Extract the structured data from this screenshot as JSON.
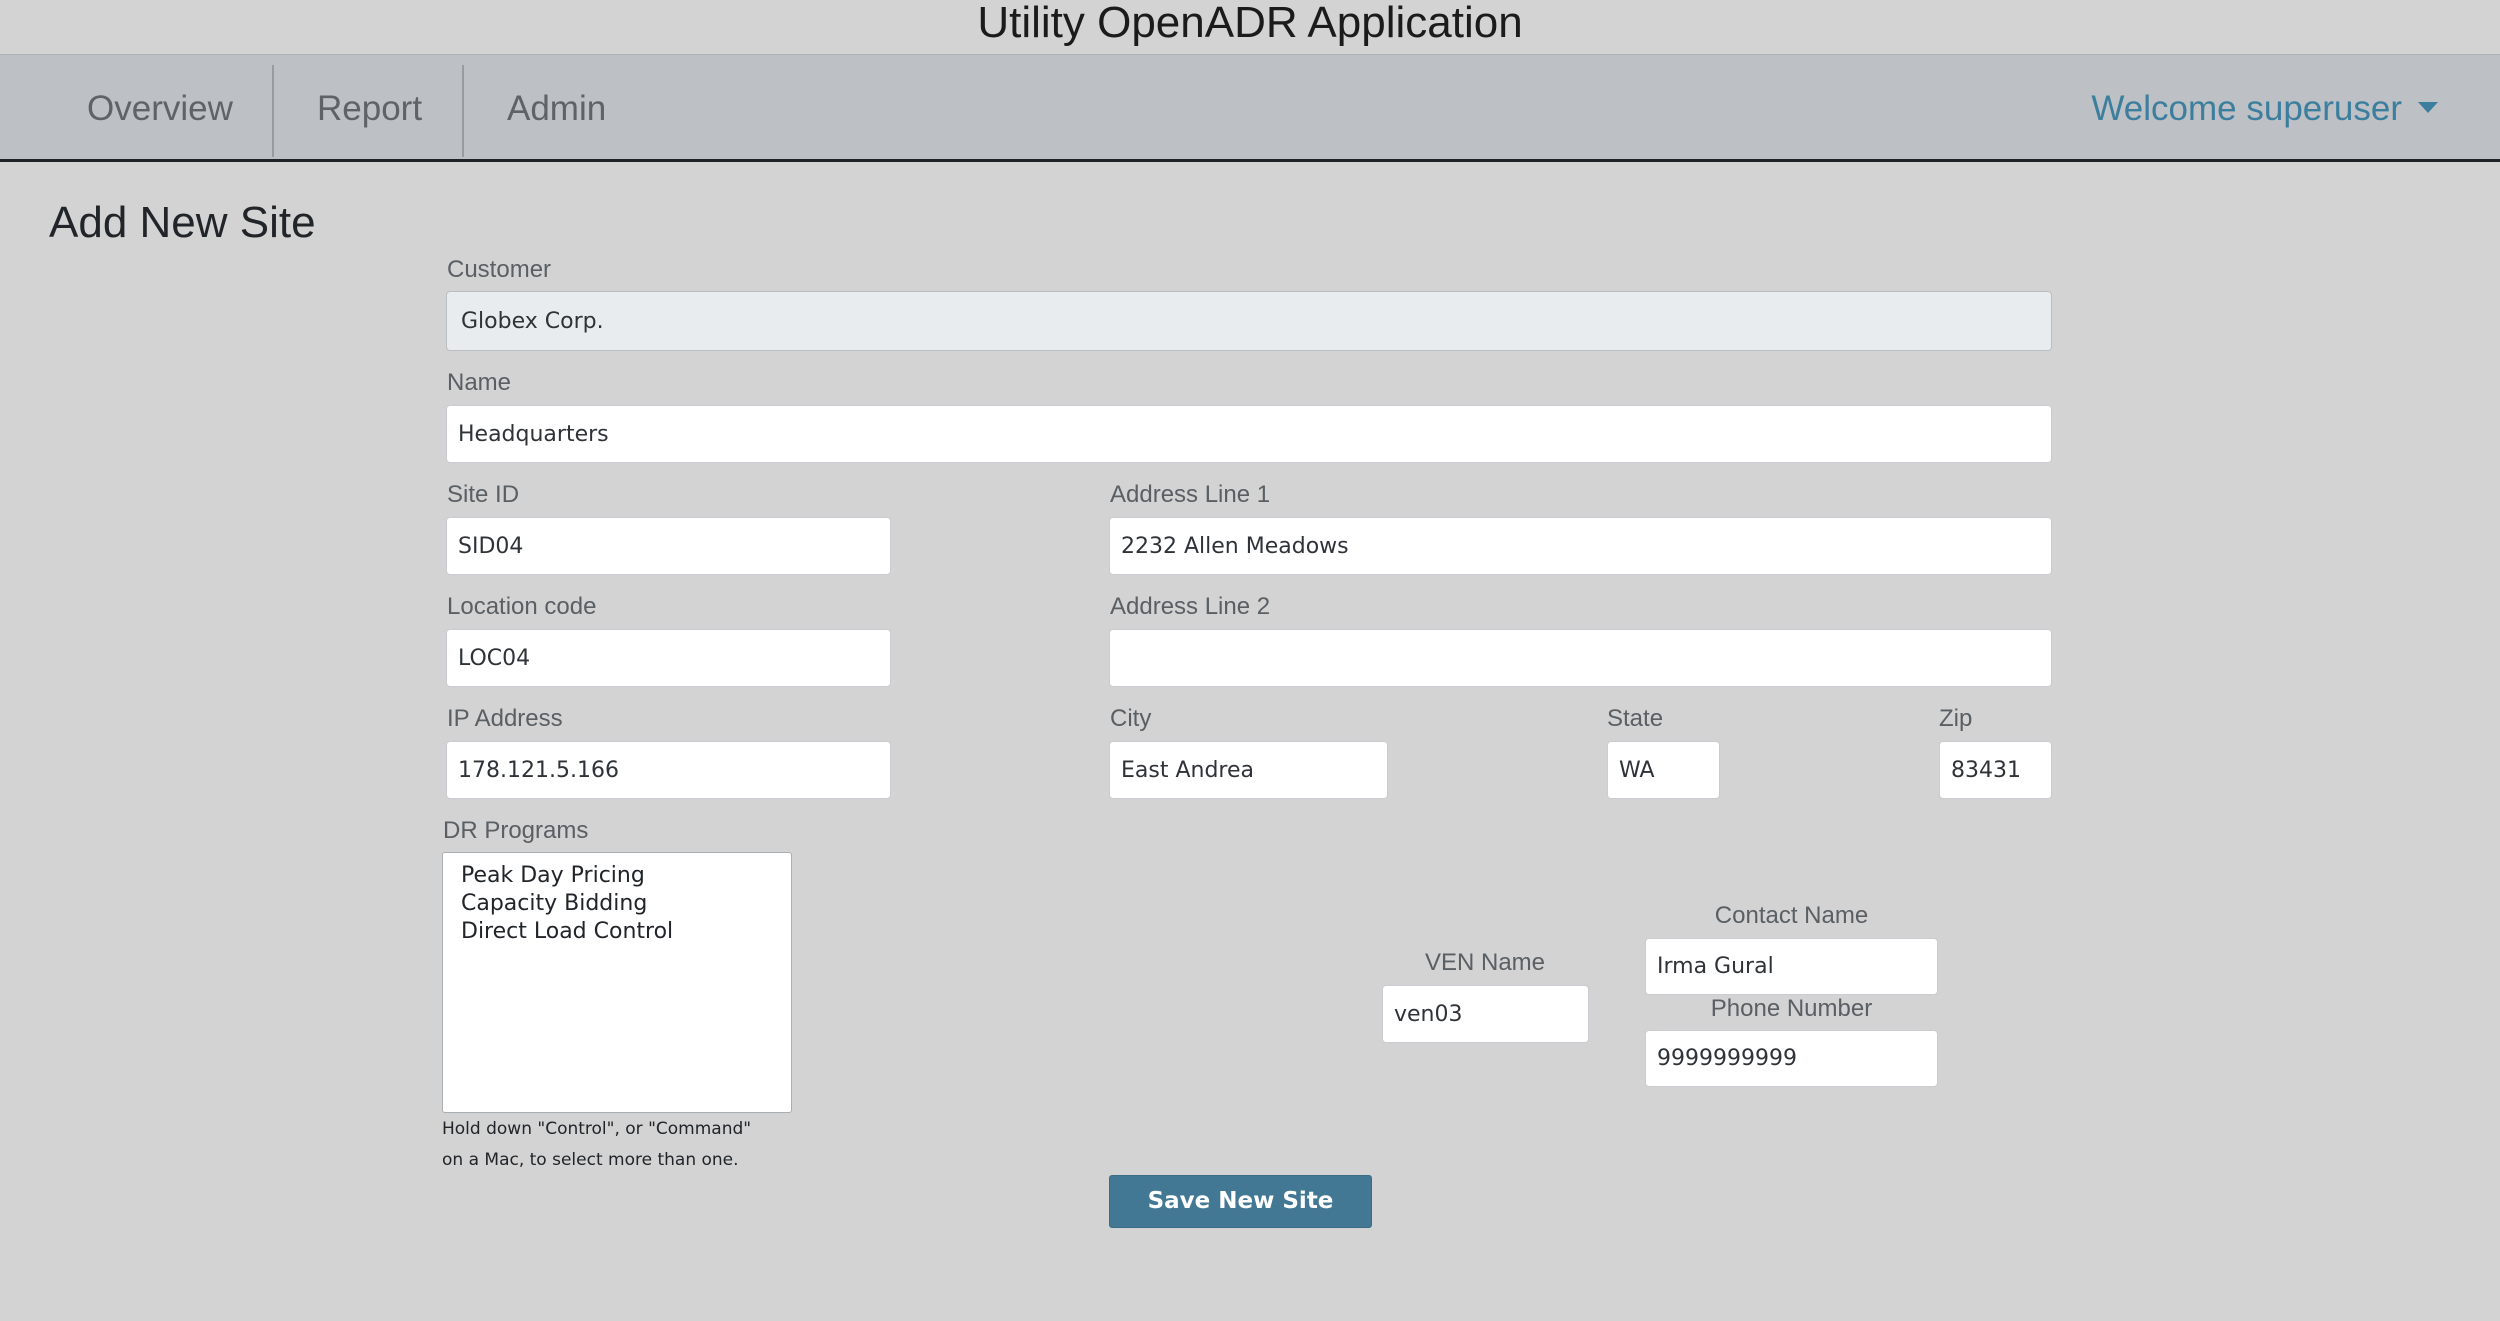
{
  "app": {
    "title": "Utility OpenADR Application"
  },
  "nav": {
    "items": [
      {
        "label": "Overview"
      },
      {
        "label": "Report"
      },
      {
        "label": "Admin"
      }
    ],
    "welcome": "Welcome superuser"
  },
  "page": {
    "title": "Add New Site"
  },
  "form": {
    "customer": {
      "label": "Customer",
      "value": "Globex Corp."
    },
    "name": {
      "label": "Name",
      "value": "Headquarters"
    },
    "site_id": {
      "label": "Site ID",
      "value": "SID04"
    },
    "address_line_1": {
      "label": "Address Line 1",
      "value": "2232 Allen Meadows"
    },
    "location_code": {
      "label": "Location code",
      "value": "LOC04"
    },
    "address_line_2": {
      "label": "Address Line 2",
      "value": ""
    },
    "ip_address": {
      "label": "IP Address",
      "value": "178.121.5.166"
    },
    "city": {
      "label": "City",
      "value": "East Andrea"
    },
    "state": {
      "label": "State",
      "value": "WA"
    },
    "zip": {
      "label": "Zip",
      "value": "83431"
    },
    "dr_programs": {
      "label": "DR Programs",
      "options": [
        "Peak Day Pricing",
        "Capacity Bidding",
        "Direct Load Control"
      ],
      "help_line_1": "Hold down \"Control\", or \"Command\"",
      "help_line_2": "on a Mac, to select more than one."
    },
    "ven_name": {
      "label": "VEN Name",
      "value": "ven03"
    },
    "contact_name": {
      "label": "Contact Name",
      "value": "Irma Gural"
    },
    "phone_number": {
      "label": "Phone Number",
      "value": "9999999999"
    },
    "save_label": "Save New Site"
  },
  "colors": {
    "background": "#d3d3d3",
    "navbar": "#bdc0c4",
    "accent": "#3c7e9e",
    "button": "#437895"
  }
}
